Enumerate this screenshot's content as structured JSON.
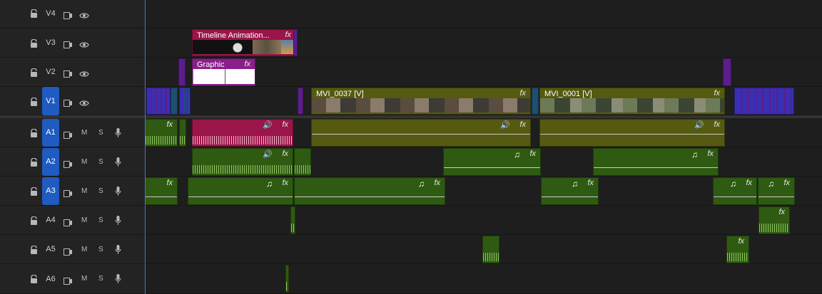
{
  "tracks": {
    "video": [
      {
        "name": "V4",
        "active": false
      },
      {
        "name": "V3",
        "active": false
      },
      {
        "name": "V2",
        "active": false
      },
      {
        "name": "V1",
        "active": true
      }
    ],
    "audio": [
      {
        "name": "A1",
        "active": true,
        "mute": "M",
        "solo": "S"
      },
      {
        "name": "A2",
        "active": true,
        "mute": "M",
        "solo": "S"
      },
      {
        "name": "A3",
        "active": true,
        "mute": "M",
        "solo": "S"
      },
      {
        "name": "A4",
        "active": false,
        "mute": "M",
        "solo": "S"
      },
      {
        "name": "A5",
        "active": false,
        "mute": "M",
        "solo": "S"
      },
      {
        "name": "A6",
        "active": false,
        "mute": "M",
        "solo": "S"
      }
    ]
  },
  "clips": {
    "v3_timeline_animation": {
      "label": "Timeline Animation...",
      "fx": "fx"
    },
    "v2_graphic": {
      "label": "Graphic",
      "fx": "fx"
    },
    "v1_mvi_0037": {
      "label": "MVI_0037 [V]",
      "fx": "fx"
    },
    "v1_mvi_0001": {
      "label": "MVI_0001 [V]",
      "fx": "fx"
    },
    "fx_label": "fx",
    "music_note": "♫",
    "volume_icon": "🔊"
  },
  "colors": {
    "accent": "#1f5bc0",
    "audio_clip": "#2f5a12",
    "title_clip": "#9a1549",
    "video_clip": "#555a10",
    "purple_clip": "#5b1e8a",
    "blue_clip": "#3a2fb3"
  },
  "icons": [
    "lock-icon",
    "film-icon",
    "eye-icon",
    "microphone-icon",
    "music-note-icon",
    "volume-icon"
  ]
}
